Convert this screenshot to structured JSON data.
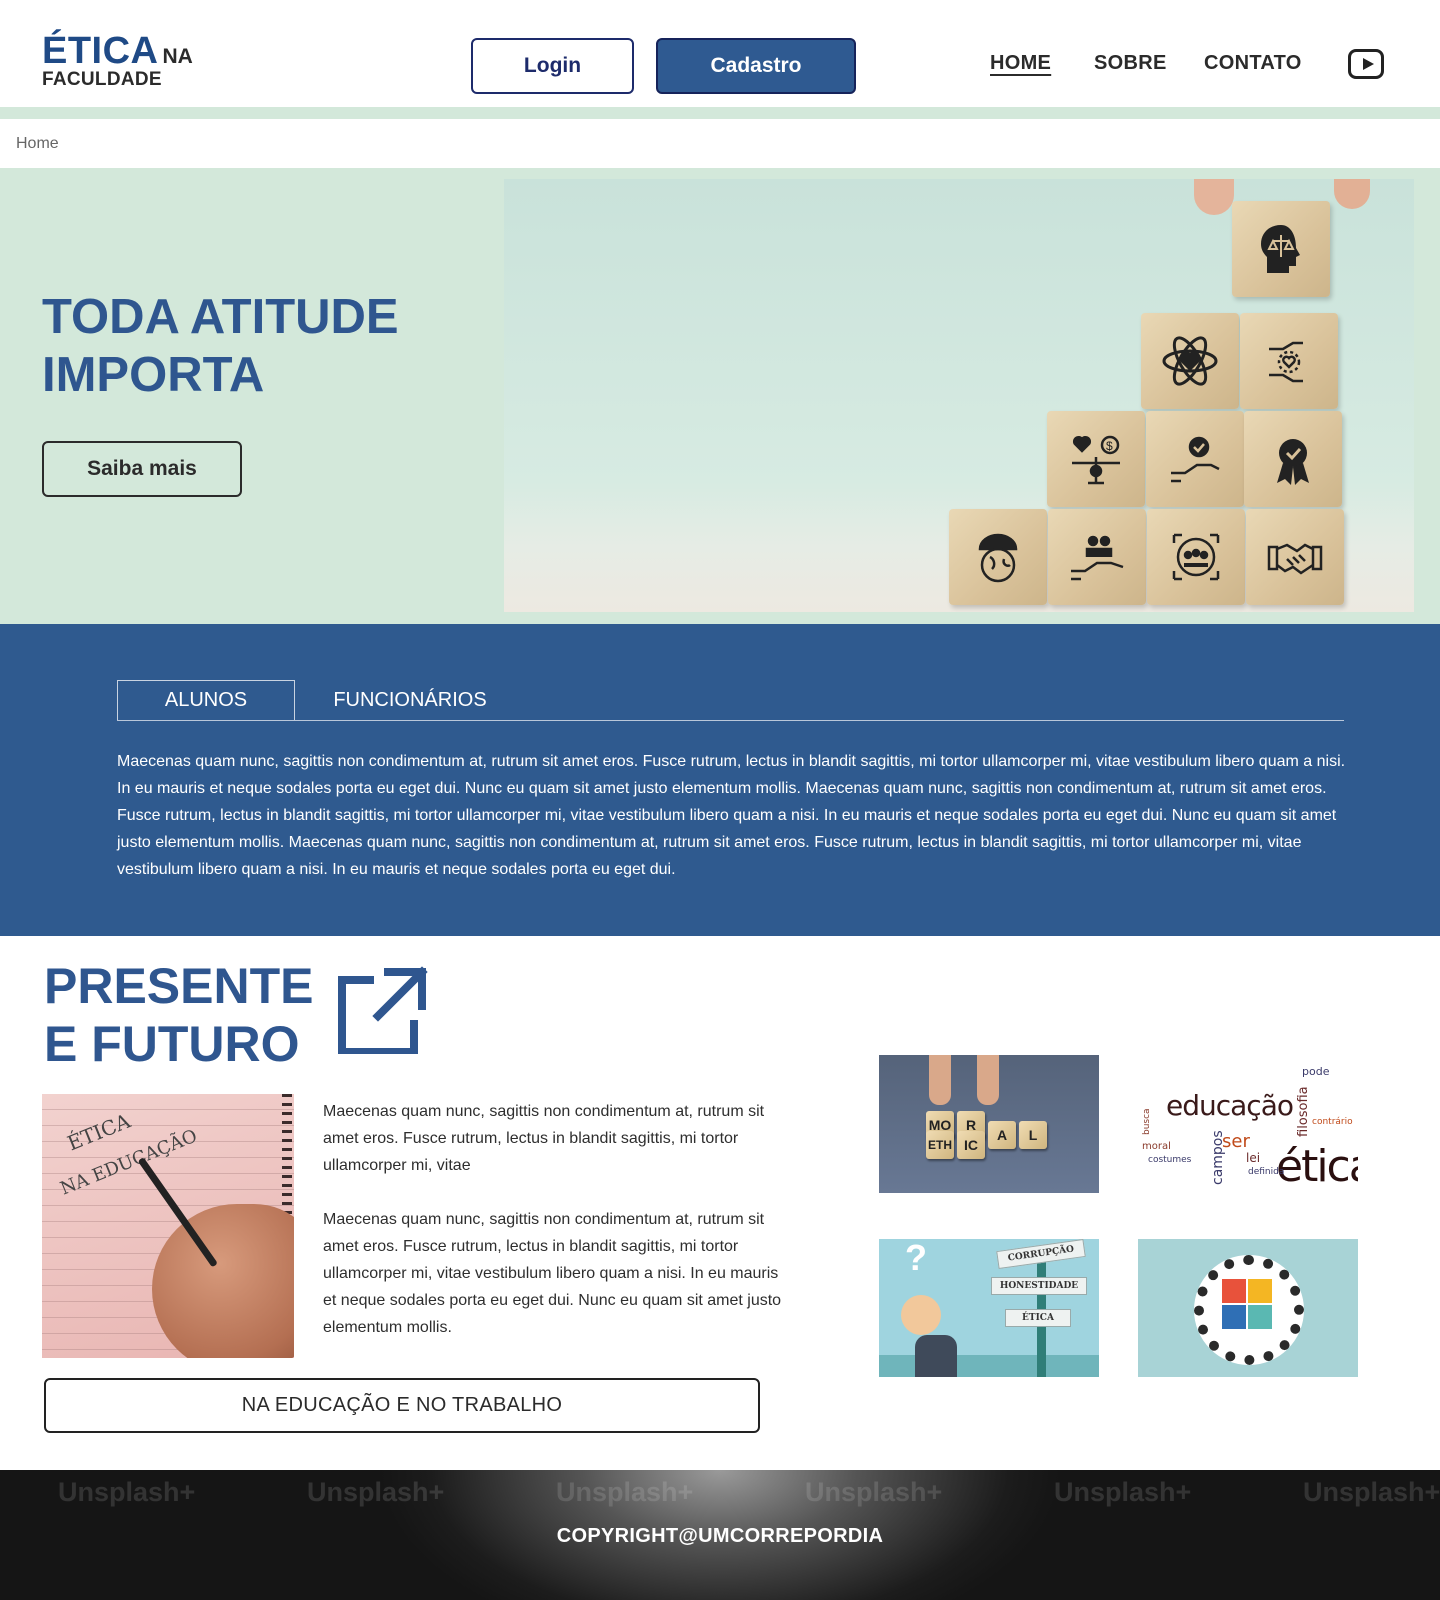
{
  "header": {
    "logo_main": "ÉTICA",
    "logo_na": "NA",
    "logo_sub": "FACULDADE",
    "login_label": "Login",
    "cadastro_label": "Cadastro",
    "nav": [
      "HOME",
      "SOBRE",
      "CONTATO"
    ],
    "active_nav": "HOME",
    "video_icon": "youtube-play-icon"
  },
  "breadcrumb": {
    "home": "Home"
  },
  "hero": {
    "title": "TODA ATITUDE IMPORTA",
    "cta_label": "Saiba mais",
    "image_icons": [
      "head-scale-icon",
      "atom-heart-icon",
      "hand-heart-icon",
      "heart-scale-money-icon",
      "hand-check-icon",
      "award-check-icon",
      "umbrella-globe-icon",
      "hand-people-icon",
      "target-people-icon",
      "handshake-icon"
    ]
  },
  "tabs": {
    "items": [
      "ALUNOS",
      "FUNCIONÁRIOS"
    ],
    "active": "ALUNOS",
    "content": "Maecenas quam nunc, sagittis non condimentum at, rutrum sit amet eros. Fusce rutrum, lectus in blandit sagittis, mi tortor ullamcorper mi, vitae vestibulum libero quam a nisi. In eu mauris et neque sodales porta eu eget dui. Nunc eu quam sit amet justo elementum mollis. Maecenas quam nunc, sagittis non condimentum at, rutrum sit amet eros. Fusce rutrum, lectus in blandit sagittis, mi tortor ullamcorper mi, vitae vestibulum libero quam a nisi. In eu mauris et neque sodales porta eu eget dui. Nunc eu quam sit amet justo elementum mollis. Maecenas quam nunc, sagittis non condimentum at, rutrum sit amet eros. Fusce rutrum, lectus in blandit sagittis, mi tortor ullamcorper mi, vitae vestibulum libero quam a nisi. In eu mauris et neque sodales porta eu eget dui."
  },
  "presente": {
    "title_line1": "PRESENTE",
    "title_line2": "E FUTURO",
    "link_icon": "external-link-icon",
    "photo_text1": "ÉTICA",
    "photo_text2": "NA EDUCAÇÃO",
    "paragraph1": "Maecenas quam nunc, sagittis non condimentum at, rutrum sit amet eros. Fusce rutrum, lectus in blandit sagittis, mi tortor ullamcorper mi, vitae",
    "paragraph2": "Maecenas quam nunc, sagittis non condimentum at, rutrum sit amet eros. Fusce rutrum, lectus in blandit sagittis, mi tortor ullamcorper mi, vitae vestibulum libero quam a nisi. In eu mauris et neque sodales porta eu eget dui. Nunc eu quam sit amet justo elementum mollis.",
    "button_label": "NA EDUCAÇÃO E NO TRABALHO",
    "thumbs": {
      "dice_top": [
        "MO",
        "R"
      ],
      "dice_bottom": [
        "ETH",
        "IC",
        "A",
        "L"
      ],
      "wordcloud_big1": "educação",
      "wordcloud_big2": "ética",
      "wordcloud_words": [
        "busca",
        "campos",
        "ser",
        "filosofia",
        "pode",
        "moral",
        "lei",
        "definida",
        "costumes",
        "contrário"
      ],
      "signs": [
        "CORRUPÇÃO",
        "HONESTIDADE",
        "ÉTICA"
      ],
      "question_mark": "?"
    }
  },
  "footer": {
    "watermark": "Unsplash+",
    "copyright": "COPYRIGHT@UMCORREPORDIA"
  }
}
